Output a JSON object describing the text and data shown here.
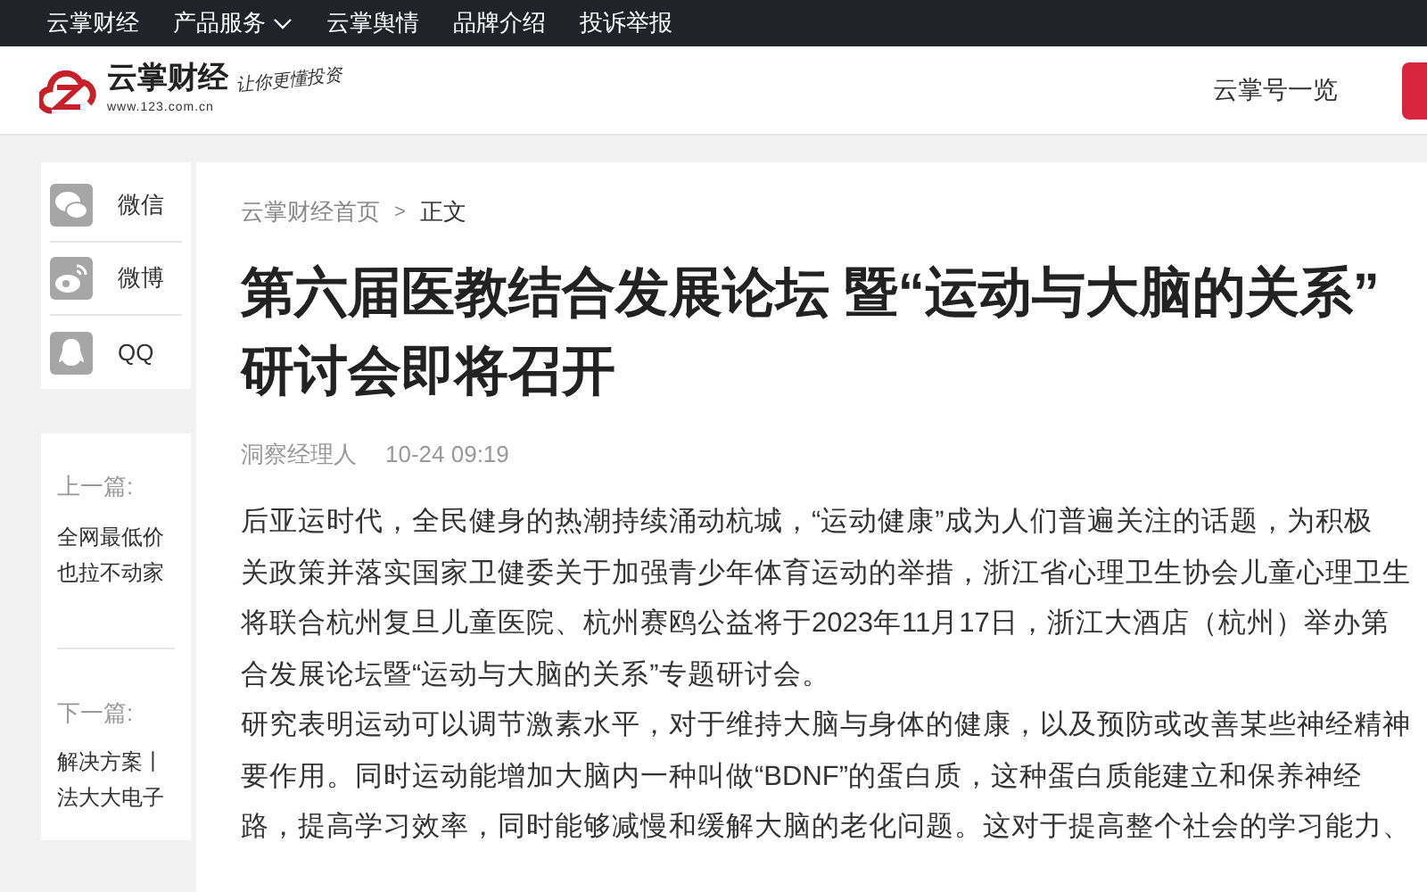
{
  "top_nav": [
    {
      "label": "云掌财经",
      "has_caret": false
    },
    {
      "label": "产品服务",
      "has_caret": true
    },
    {
      "label": "云掌舆情",
      "has_caret": false
    },
    {
      "label": "品牌介绍",
      "has_caret": false
    },
    {
      "label": "投诉举报",
      "has_caret": false
    }
  ],
  "header": {
    "logo_text": "云掌财经",
    "logo_url": "www.123.com.cn",
    "slogan": "让你更懂投资",
    "link": "云掌号一览"
  },
  "share": [
    {
      "kind": "wechat",
      "label": "微信"
    },
    {
      "kind": "weibo",
      "label": "微博"
    },
    {
      "kind": "qq",
      "label": "QQ"
    }
  ],
  "adjacent": [
    {
      "heading": "上一篇:",
      "title_lines": [
        "全网最低价",
        "也拉不动家"
      ]
    },
    {
      "heading": "下一篇:",
      "title_lines": [
        "解决方案丨",
        "法大大电子"
      ]
    }
  ],
  "breadcrumb": {
    "home": "云掌财经首页",
    "separator": ">",
    "current": "正文"
  },
  "article": {
    "title_lines": [
      "第六届医教结合发展论坛 暨“运动与大脑的关系”",
      "研讨会即将召开"
    ],
    "author": "洞察经理人",
    "time": "10-24 09:19",
    "paragraphs": [
      [
        "后亚运时代，全民健身的热潮持续涌动杭城，“运动健康”成为人们普遍关注的话题，为积极",
        "关政策并落实国家卫健委关于加强青少年体育运动的举措，浙江省心理卫生协会儿童心理卫生",
        "将联合杭州复旦儿童医院、杭州赛鸥公益将于2023年11月17日，浙江大酒店（杭州）举办第",
        "合发展论坛暨“运动与大脑的关系”专题研讨会。"
      ],
      [
        "研究表明运动可以调节激素水平，对于维持大脑与身体的健康，以及预防或改善某些神经精神",
        "要作用。同时运动能增加大脑内一种叫做“BDNF”的蛋白质，这种蛋白质能建立和保养神经",
        "路，提高学习效率，同时能够减慢和缓解大脑的老化问题。这对于提高整个社会的学习能力、"
      ]
    ]
  }
}
